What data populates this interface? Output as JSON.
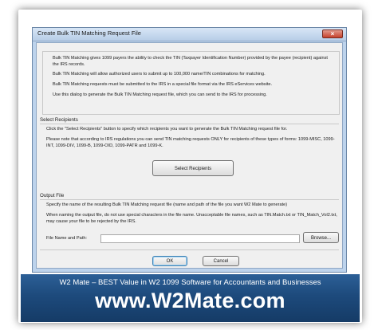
{
  "window": {
    "title": "Create Bulk TIN Matching Request File",
    "close_glyph": "×"
  },
  "intro": {
    "p1": "Bulk TIN Matching gives 1099 payers the ability to check the TIN (Taxpayer Identification Number) provided by the payee (recipient) against the IRS records.",
    "p2": "Bulk TIN Matching will allow authorized users to submit up to 100,000 name/TIN combinations for matching.",
    "p3": "Bulk TIN Matching requests must be submitted to the IRS in a special file format via the IRS eServices website.",
    "p4": "Use this dialog to generate the Bulk TIN Matching request file, which you can send to the IRS for processing."
  },
  "recipients": {
    "section_title": "Select Recipients",
    "p1": "Click the \"Select Recipients\" button to specify which recipients you want to generate the Bulk TIN Matching request file for.",
    "p2": "Please note that according to IRS regulations you can send TIN matching requests ONLY for recipients of these types of forms: 1099-MISC, 1099-INT, 1099-DIV, 1099-B, 1099-OID, 1099-PATR and 1099-K.",
    "button_label": "Select Recipients"
  },
  "output": {
    "section_title": "Output File",
    "p1": "Specify the name of the resulting Bulk TIN Matching request file (name and path of the file you want W2 Mate to generate)",
    "p2": "When naming the output file, do not use special characters in the file name. Unacceptable file names, such as TIN.Match.txt or TIN_Match_Vol2.txt, may cause your file to be rejected by the IRS.",
    "field_label": "File Name and Path:",
    "field_value": "",
    "browse_label": "Browse..."
  },
  "footer": {
    "ok_label": "OK",
    "cancel_label": "Cancel"
  },
  "banner": {
    "tagline": "W2 Mate – BEST Value in W2 1099 Software for Accountants and Businesses",
    "site": "www.W2Mate.com"
  }
}
